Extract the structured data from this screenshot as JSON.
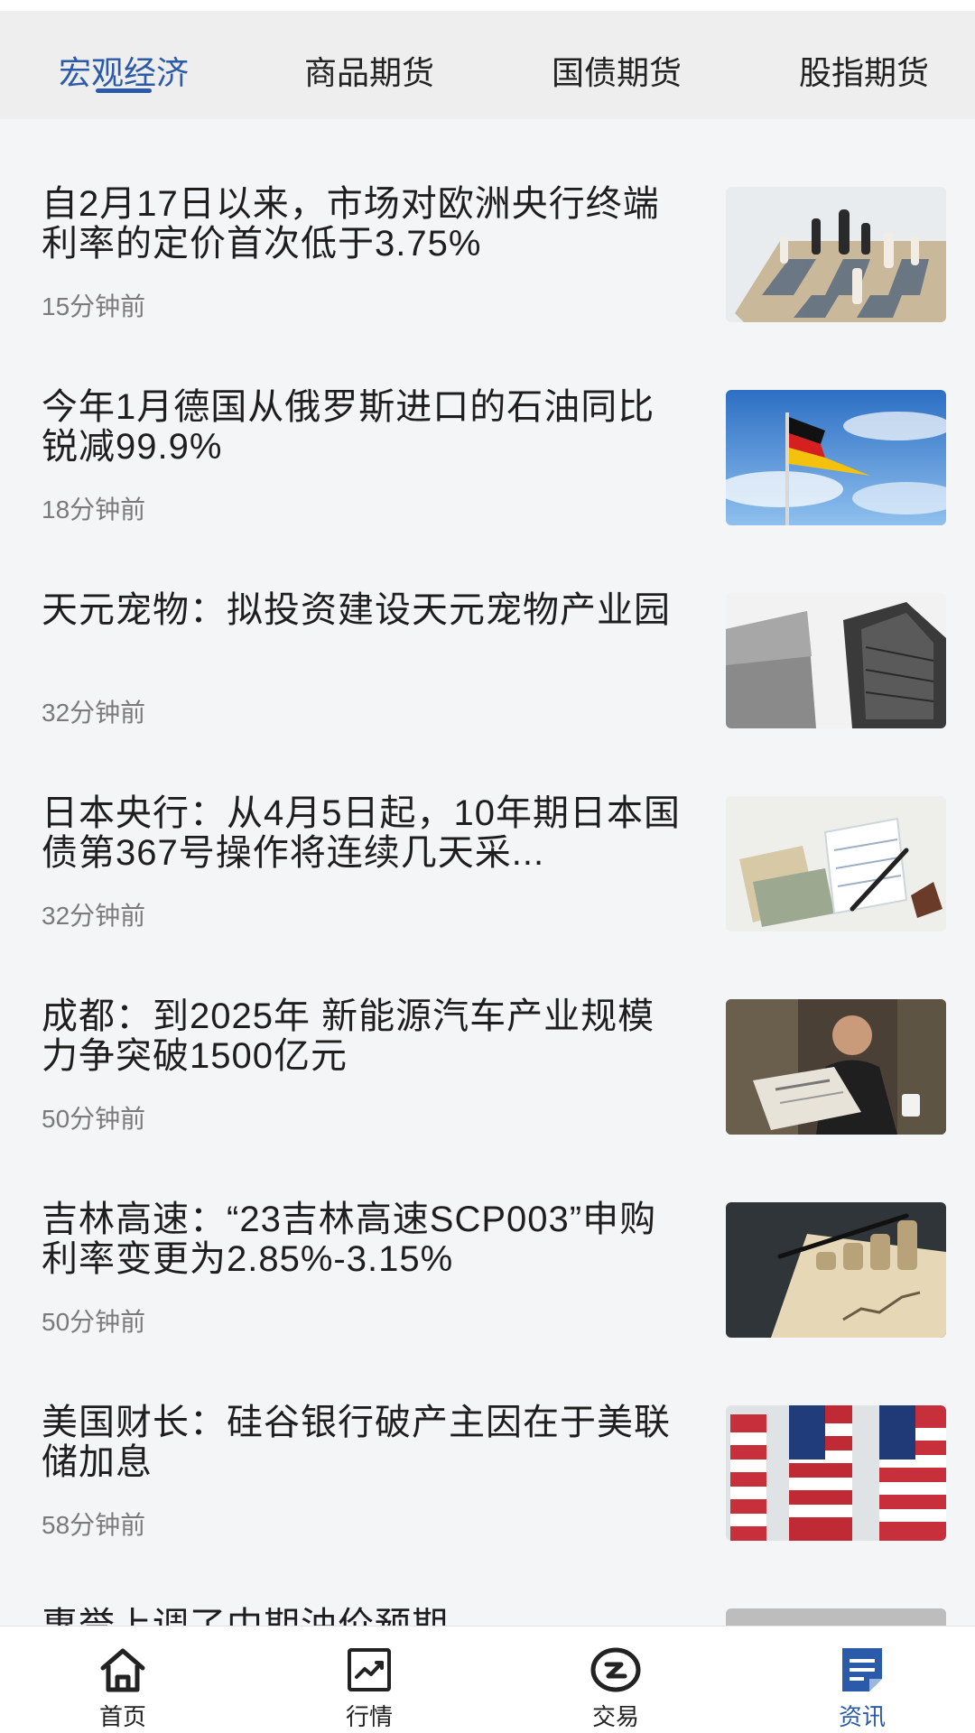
{
  "tabs": [
    {
      "label": "宏观经济",
      "active": true
    },
    {
      "label": "商品期货",
      "active": false
    },
    {
      "label": "国债期货",
      "active": false
    },
    {
      "label": "股指期货",
      "active": false
    }
  ],
  "news": [
    {
      "title": "自2月17日以来，市场对欧洲央行终端利率的定价首次低于3.75%",
      "time": "15分钟前",
      "image": "chess-image"
    },
    {
      "title": "今年1月德国从俄罗斯进口的石油同比锐减99.9%",
      "time": "18分钟前",
      "image": "german-flag-image"
    },
    {
      "title": "天元宠物：拟投资建设天元宠物产业园",
      "time": "32分钟前",
      "image": "skyscrapers-image"
    },
    {
      "title": "日本央行：从4月5日起，10年期日本国债第367号操作将连续几天采...",
      "time": "32分钟前",
      "image": "banknotes-pen-image"
    },
    {
      "title": "成都：到2025年 新能源汽车产业规模力争突破1500亿元",
      "time": "50分钟前",
      "image": "newspaper-man-image"
    },
    {
      "title": "吉林高速：“23吉林高速SCP003”申购利率变更为2.85%-3.15%",
      "time": "50分钟前",
      "image": "coins-notebook-image"
    },
    {
      "title": "美国财长：硅谷银行破产主因在于美联储加息",
      "time": "58分钟前",
      "image": "us-flags-image"
    },
    {
      "title": "惠誉上调了中期油价预期",
      "time": "",
      "image": "partial-image"
    }
  ],
  "bottom_nav": [
    {
      "label": "首页",
      "icon": "home-icon",
      "active": false
    },
    {
      "label": "行情",
      "icon": "market-chart-icon",
      "active": false
    },
    {
      "label": "交易",
      "icon": "trade-icon",
      "active": false
    },
    {
      "label": "资讯",
      "icon": "news-icon",
      "active": true
    }
  ],
  "colors": {
    "accent": "#2a5aa8",
    "tab_bar_bg": "#eeeeee",
    "list_bg": "#f4f5f7",
    "time_text": "#7a7a7a"
  }
}
